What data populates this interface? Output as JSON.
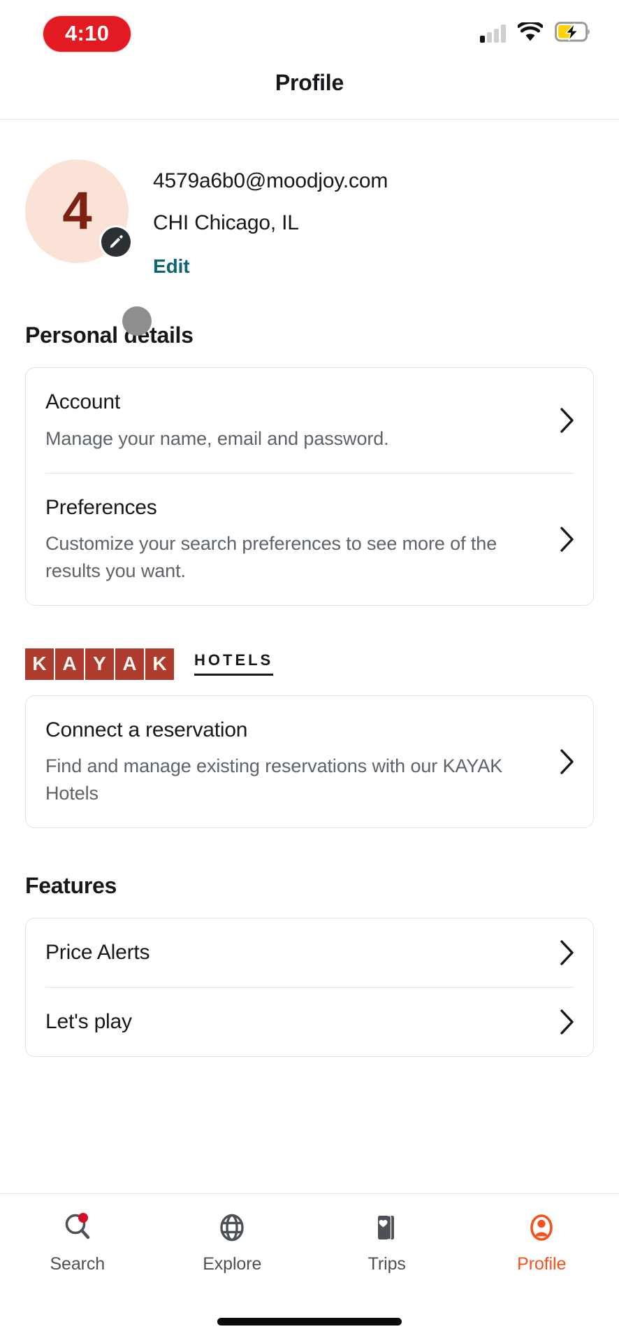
{
  "status_bar": {
    "time": "4:10",
    "time_pill_color": "#E21B22",
    "signal_icon": "cellular-signal-icon",
    "signal_bars_total": 4,
    "signal_bars_active": 1,
    "wifi_icon": "wifi-icon",
    "battery_icon": "battery-charging-icon",
    "battery_color": "#FFD400"
  },
  "header": {
    "title": "Profile"
  },
  "profile": {
    "avatar_initial": "4",
    "avatar_bg_color": "#FBE2D6",
    "avatar_text_color": "#7D2113",
    "edit_badge_icon": "pencil-icon",
    "email": "4579a6b0@moodjoy.com",
    "location": "CHI Chicago, IL",
    "edit_label": "Edit",
    "edit_link_color": "#0C6573"
  },
  "personal_details": {
    "section_title": "Personal details",
    "rows": [
      {
        "title": "Account",
        "subtitle": "Manage your name, email and password.",
        "chevron": "chevron-right-icon"
      },
      {
        "title": "Preferences",
        "subtitle": "Customize your search preferences to see more of the results you want.",
        "chevron": "chevron-right-icon"
      }
    ]
  },
  "kayak_brand": {
    "letters": [
      "K",
      "A",
      "Y",
      "A",
      "K"
    ],
    "tile_color": "#AE3C2E",
    "suffix": "HOTELS"
  },
  "reservation": {
    "title": "Connect a reservation",
    "subtitle": "Find and manage existing reservations with our KAYAK Hotels",
    "chevron": "chevron-right-icon"
  },
  "features": {
    "section_title": "Features",
    "rows": [
      {
        "title": "Price Alerts",
        "chevron": "chevron-right-icon"
      },
      {
        "title": "Let's play",
        "chevron": "chevron-right-icon"
      }
    ]
  },
  "bottom_nav": {
    "active_color": "#F6511D",
    "inactive_color": "#4B5156",
    "items": [
      {
        "label": "Search",
        "icon": "search-icon",
        "badge": true,
        "active": false
      },
      {
        "label": "Explore",
        "icon": "globe-icon",
        "badge": false,
        "active": false
      },
      {
        "label": "Trips",
        "icon": "cards-heart-icon",
        "badge": false,
        "active": false
      },
      {
        "label": "Profile",
        "icon": "person-circle-icon",
        "badge": false,
        "active": true
      }
    ]
  },
  "touch_indicator": {
    "name": "touch-point-indicator",
    "color": "#8E8E8E"
  }
}
